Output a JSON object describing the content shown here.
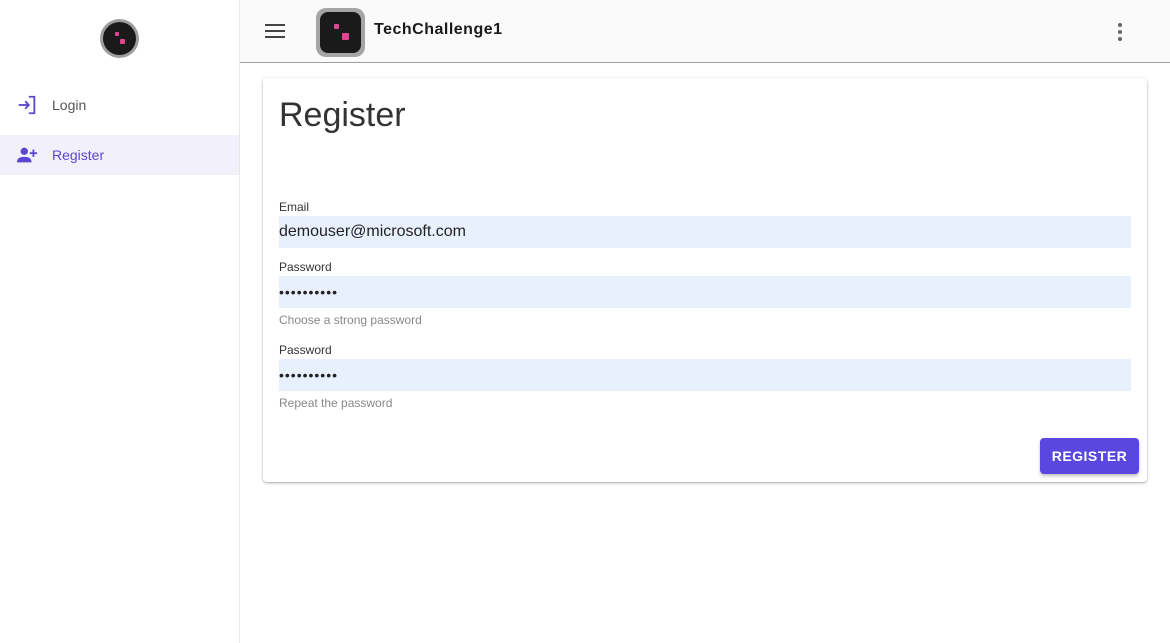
{
  "header": {
    "app_title": "TechChallenge1",
    "menu_icon": "menu-icon",
    "more_icon": "more-vert-icon"
  },
  "sidebar": {
    "items": [
      {
        "label": "Login",
        "icon": "login-icon"
      },
      {
        "label": "Register",
        "icon": "person-add-icon",
        "active": true
      }
    ]
  },
  "register": {
    "title": "Register",
    "email_label": "Email",
    "email_value": "demouser@microsoft.com",
    "password_label": "Password",
    "password_value": "••••••••••",
    "password_hint": "Choose a strong password",
    "confirm_label": "Password",
    "confirm_value": "••••••••••",
    "confirm_hint": "Repeat the password",
    "submit_label": "REGISTER"
  },
  "colors": {
    "accent": "#5a47e0",
    "active_bg": "#f2f0fb",
    "input_bg": "#e8f0fe",
    "logo_dot": "#e0458f"
  }
}
